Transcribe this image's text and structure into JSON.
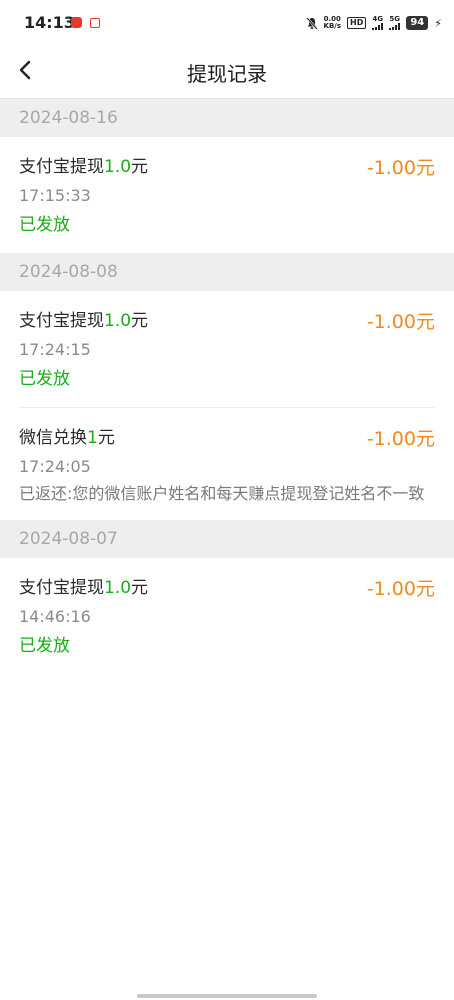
{
  "status_bar": {
    "time": "14:13",
    "net_speed_value": "0.00",
    "net_speed_unit": "KB/s",
    "hd_label": "HD",
    "network_1": "4G",
    "network_2": "5G",
    "battery": "94"
  },
  "header": {
    "title": "提现记录"
  },
  "groups": [
    {
      "date": "2024-08-16",
      "records": [
        {
          "title_prefix": "支付宝提现",
          "title_num": "1.0",
          "title_suffix": "元",
          "amount": "-1.00元",
          "time": "17:15:33",
          "status": "已发放",
          "status_type": "ok"
        }
      ]
    },
    {
      "date": "2024-08-08",
      "records": [
        {
          "title_prefix": "支付宝提现",
          "title_num": "1.0",
          "title_suffix": "元",
          "amount": "-1.00元",
          "time": "17:24:15",
          "status": "已发放",
          "status_type": "ok"
        },
        {
          "title_prefix": "微信兑换",
          "title_num": "1",
          "title_suffix": "元",
          "amount": "-1.00元",
          "time": "17:24:05",
          "status": "已返还:您的微信账户姓名和每天赚点提现登记姓名不一致",
          "status_type": "fail"
        }
      ]
    },
    {
      "date": "2024-08-07",
      "records": [
        {
          "title_prefix": "支付宝提现",
          "title_num": "1.0",
          "title_suffix": "元",
          "amount": "-1.00元",
          "time": "14:46:16",
          "status": "已发放",
          "status_type": "ok"
        }
      ]
    }
  ],
  "colors": {
    "accent_green": "#1aad19",
    "amount_orange": "#f2891f",
    "date_header_bg": "#eeeeee"
  }
}
